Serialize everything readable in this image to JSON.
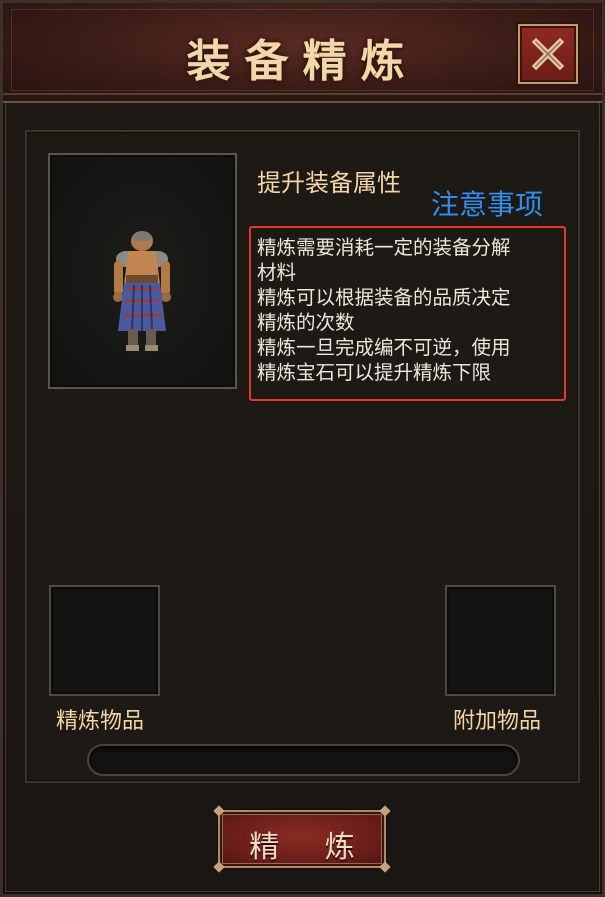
{
  "window": {
    "title": "装备精炼",
    "close_icon": "close-icon"
  },
  "preview": {
    "icon": "character-preview-icon"
  },
  "attributes": {
    "title": "提升装备属性"
  },
  "notice": {
    "title": "注意事项",
    "lines": [
      "精炼需要消耗一定的装备分解",
      "材料",
      "精炼可以根据装备的品质决定",
      "精炼的次数",
      "精炼一旦完成编不可逆，使用",
      "精炼宝石可以提升精炼下限"
    ]
  },
  "slots": {
    "refine_item_label": "精炼物品",
    "extra_item_label": "附加物品"
  },
  "progress": {
    "value": 0
  },
  "actions": {
    "refine_label": "精 炼"
  },
  "colors": {
    "gold_text": "#f4d6a6",
    "notice_blue": "#2f8ff0",
    "highlight_red": "#e23a30",
    "button_red": "#6c1c17"
  }
}
